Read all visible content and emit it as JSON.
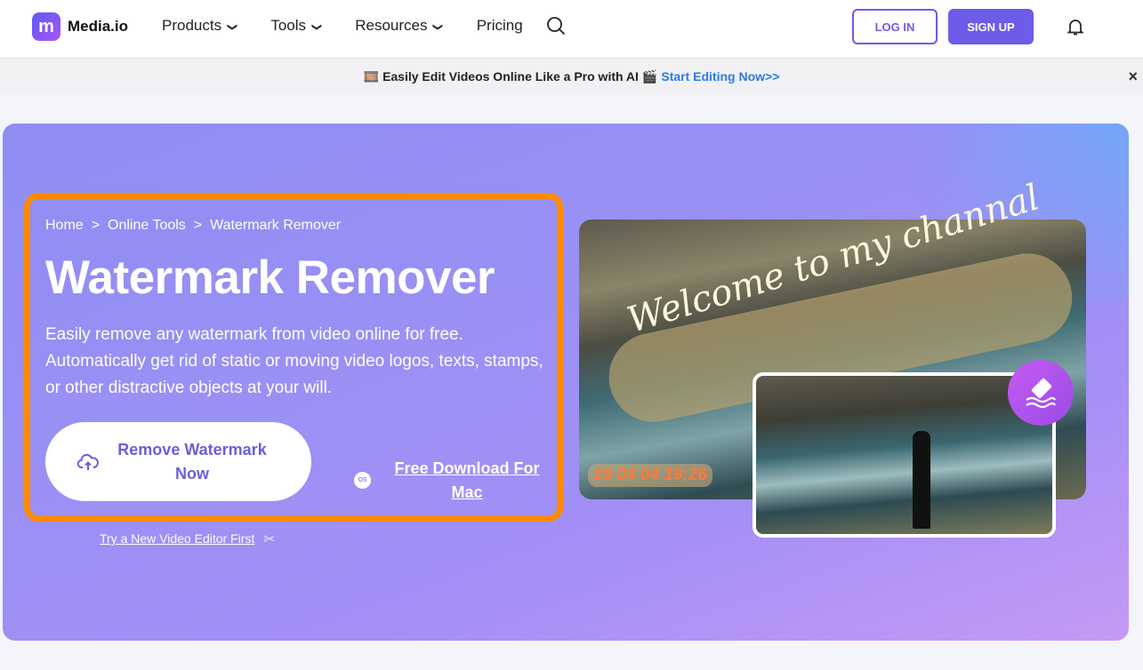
{
  "nav": {
    "brand": "Media.io",
    "logo_letter": "m",
    "items": [
      {
        "label": "Products",
        "dropdown": true
      },
      {
        "label": "Tools",
        "dropdown": true
      },
      {
        "label": "Resources",
        "dropdown": true
      },
      {
        "label": "Pricing",
        "dropdown": false
      }
    ],
    "login": "LOG IN",
    "signup": "SIGN UP",
    "accent": "#6c5ce7"
  },
  "banner": {
    "emoji_left": "🎞️",
    "text": "Easily Edit Videos Online Like a Pro with AI",
    "emoji_right": "🎬",
    "link": "Start Editing Now>>",
    "close": "×"
  },
  "hero": {
    "breadcrumb": [
      "Home",
      "Online Tools",
      "Watermark Remover"
    ],
    "separator": ">",
    "title": "Watermark Remover",
    "description": "Easily remove any watermark from video online for free. Automatically get rid of static or moving video logos, texts, stamps, or other distractive objects at your will.",
    "cta": "Remove Watermark Now",
    "mac_icon": "OS",
    "download": "Free Download For Mac",
    "try_link": "Try a New Video Editor First",
    "highlight_color": "#ff8a00"
  },
  "media": {
    "watermark_text": "Welcome to my channal",
    "timestamp": "19 04 04 19:26"
  }
}
